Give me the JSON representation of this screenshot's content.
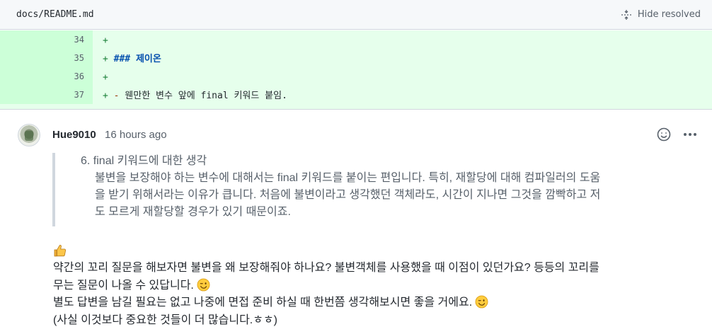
{
  "file_header": {
    "path": "docs/README.md",
    "hide_resolved_label": "Hide resolved"
  },
  "diff": {
    "lines": [
      {
        "number": "34",
        "marker": "+",
        "content": ""
      },
      {
        "number": "35",
        "marker": "+",
        "content": "### 제이온"
      },
      {
        "number": "36",
        "marker": "+",
        "content": ""
      },
      {
        "number": "37",
        "marker": "+",
        "bullet": "-",
        "content": " 웬만한 변수 앞에 final 키워드 붙임."
      }
    ]
  },
  "comment": {
    "author": "Hue9010",
    "timestamp": "16 hours ago",
    "quote": {
      "title": "6. final 키워드에 대한 생각",
      "lines": [
        "불변을 보장해야 하는 변수에 대해서는 final 키워드를 붙이는 편입니다. 특히, 재할당에 대해 컴파일러의 도움",
        "을 받기 위해서라는 이유가 큽니다. 처음에 불변이라고 생각했던 객체라도, 시간이 지나면 그것을 깜빡하고 저",
        "도 모르게 재할당할 경우가 있기 때문이죠."
      ]
    },
    "reply": {
      "line1": "약간의 꼬리 질문을 해보자면 불변을 왜 보장해줘야 하나요? 불변객체를 사용했을 때 이점이 있던가요? 등등의 꼬리를",
      "line2": "무는 질문이 나올 수 있답니다.",
      "line3": "별도 답변을 남길 필요는 없고 나중에 면접 준비 하실 때 한번쯤 생각해보시면 좋을 거에요.",
      "line4": "(사실 이것보다 중요한 것들이 더 많습니다.ㅎㅎ)"
    },
    "emoji": {
      "thumbs_up": "thumbs-up-icon",
      "wink": "wink-face-icon"
    }
  },
  "colors": {
    "addition_bg": "#e6ffec",
    "addition_num_bg": "#ccffd8",
    "heading_blue": "#0550ae",
    "muted": "#57606a"
  }
}
